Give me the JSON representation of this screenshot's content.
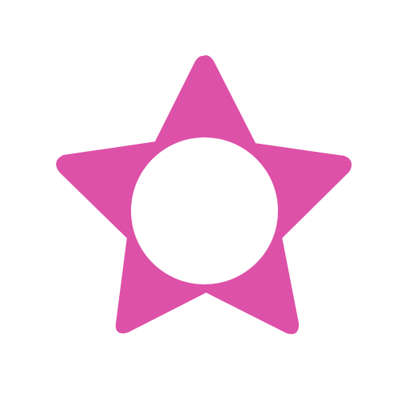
{
  "colors": {
    "background": "#ffffff",
    "star": "#DD51A8",
    "center_circle": "#ffffff"
  },
  "icon": {
    "name": "star-with-circle-icon"
  }
}
